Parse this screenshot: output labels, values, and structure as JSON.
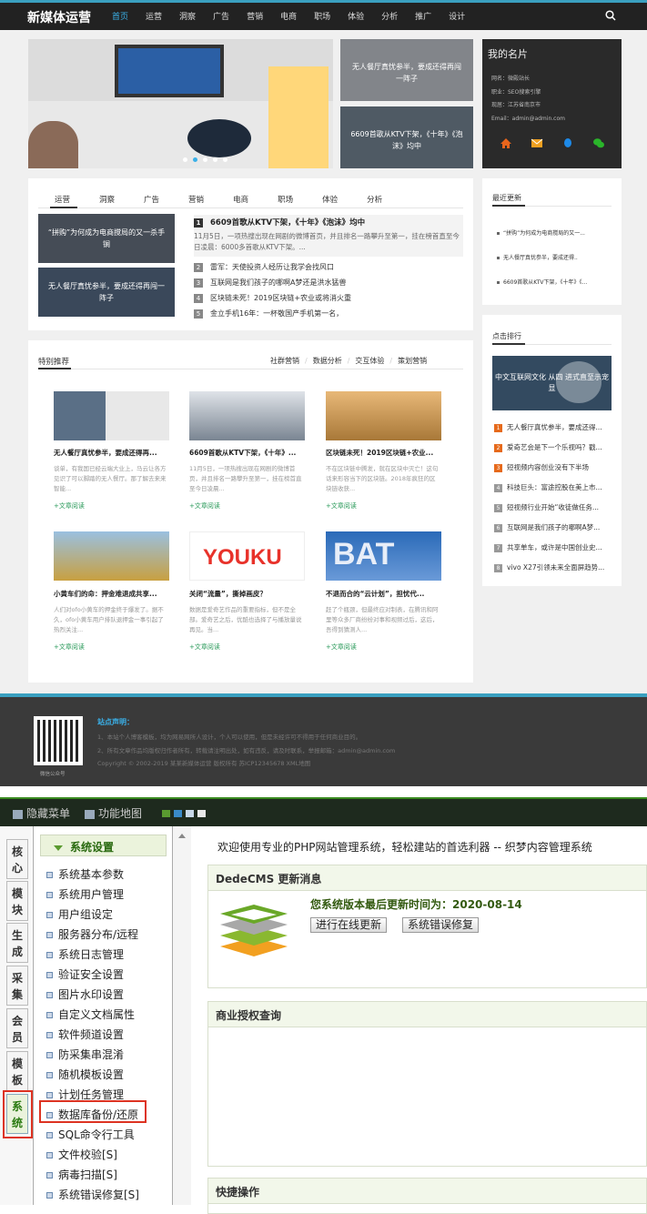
{
  "site": {
    "logo": "新媒体运营",
    "nav": [
      "首页",
      "运营",
      "洞察",
      "广告",
      "营销",
      "电商",
      "职场",
      "体验",
      "分析",
      "推广",
      "设计"
    ],
    "slider_thumbs": [
      "无人餐厅真忧参半，要成还得再闯一阵子",
      "6609首歌从KTV下架，《十年》《泡沫》均中"
    ],
    "card": {
      "title": "我的名片",
      "lines": [
        "网名：微殿站长",
        "职业：SEO搜索引擎",
        "现居：江苏省南京市",
        "Email：admin@admin.com"
      ]
    },
    "tabs": [
      "运营",
      "洞察",
      "广告",
      "营销",
      "电商",
      "职场",
      "体验",
      "分析"
    ],
    "news_imgs": [
      "“拼购”为何成为电商搅局的又一杀手锏",
      "无人餐厅真忧参半，要成还得再闯一阵子"
    ],
    "headline": {
      "num": "1",
      "title": "6609首歌从KTV下架，《十年》《泡沫》均中",
      "desc": "11月5日，一项热搜出现在网剧的微博首页，并且排名一路攀升至第一，挂在榜首直至今日凌晨：6000多首歌从KTV下架。..."
    },
    "news_list": [
      {
        "num": "2",
        "title": "雷军：天使投资人经历让我学会找风口"
      },
      {
        "num": "3",
        "title": "互联网是我们孩子的哪啊A梦还是洪水猛兽"
      },
      {
        "num": "4",
        "title": "区块链未死！2019区块链+农业或将消火重"
      },
      {
        "num": "5",
        "title": "金立手机16年：一杯敬国产手机第一名，"
      }
    ],
    "recent_title": "最近更新",
    "recent": [
      "“拼购”为何成为电商搅局的又一...",
      "无人餐厅真忧参半，要成还得..",
      "6609首歌从KTV下架，《十年》《..."
    ],
    "rank_title": "点击排行",
    "rank_img_text": "中文互联网文化 从四 进式直至示宠显",
    "rank": [
      {
        "num": "1",
        "title": "无人餐厅真忧参半，要成还得..."
      },
      {
        "num": "2",
        "title": "爱奇艺会是下一个乐视吗？戳..."
      },
      {
        "num": "3",
        "title": "短视频内容创业没有下半场"
      },
      {
        "num": "4",
        "title": "科技巨头：富途控股在美上市..."
      },
      {
        "num": "5",
        "title": "短视频行业开始“收徒做任务..."
      },
      {
        "num": "6",
        "title": "互联网是我们孩子的哪啊A梦..."
      },
      {
        "num": "7",
        "title": "共享单车，或许是中国创业史..."
      },
      {
        "num": "8",
        "title": "vivo X27引领未来全面屏趋势..."
      }
    ],
    "featured_title": "特别推荐",
    "featured_links": [
      "社群营销",
      "数据分析",
      "交互体验",
      "策划营销"
    ],
    "featured": [
      {
        "title": "无人餐厅真忧参半，要成还得再...",
        "desc": "谈单，有我国已经云端大业上，马云让各方见识了可以脚踏的无人餐厅。那了解去来来智能...",
        "more": "+文章阅读"
      },
      {
        "title": "6609首歌从KTV下架，《十年》...",
        "desc": "11月5日，一项热搜出现在网剧的微博首页，并且排名一路攀升至第一，挂在榜首直至今日凌晨...",
        "more": "+文章阅读"
      },
      {
        "title": "区块链未死！2019区块链+农业...",
        "desc": "不在区块链中腾发，就在区块中灭亡！这句话来形容当下的区块链。2018年疯狂的区块链收获...",
        "more": "+文章阅读"
      },
      {
        "title": "小黄车们的命：押金难退成共享...",
        "desc": "人们对ofo小黄车的押金终于爆发了。据不久，ofo小黄车用户排队退押金一事引起了热烈关注...",
        "more": "+文章阅读"
      },
      {
        "title": "关闭“流量”，撕掉画皮？",
        "desc": "数据是爱奇艺作品的重要指标，但不是全部。爱奇艺之后，优酷也选择了与播放量说再见。当...",
        "more": "+文章阅读"
      },
      {
        "title": "不退而合的“云计划”，担忧代...",
        "desc": "赶了个瓶颈，但最终应对制表，在腾讯和阿里等众多厂商纷纷对事和视频过后，这后，吾得到猜测人...",
        "more": "+文章阅读"
      }
    ],
    "footer": {
      "qr_label": "微信公众号",
      "title": "站点声明：",
      "lines": [
        "1、本站个人博客模板，均为网易网所人设计，个人可以使用，但是未经许可不得用于任何商业目的。",
        "2、所有文章作品均版权归作者所有，转载请注明出处，如有违反，请及时联系，举报邮箱：admin@admin.com",
        "Copyright © 2002-2019 某某新媒体运营 版权所有 苏ICP12345678 XML地图"
      ]
    }
  },
  "admin": {
    "topbar": {
      "hide_menu": "隐藏菜单",
      "site_map": "功能地图"
    },
    "swatches": [
      "#5a9a30",
      "#3a8ac8",
      "#c8d8e8",
      "#e8e8e8"
    ],
    "side_tabs": [
      "核心",
      "模块",
      "生成",
      "采集",
      "会员",
      "模板",
      "系统"
    ],
    "menu_title": "系统设置",
    "menu_items": [
      "系统基本参数",
      "系统用户管理",
      "用户组设定",
      "服务器分布/远程",
      "系统日志管理",
      "验证安全设置",
      "图片水印设置",
      "自定义文档属性",
      "软件频道设置",
      "防采集串混淆",
      "随机模板设置",
      "计划任务管理",
      "数据库备份/还原",
      "SQL命令行工具",
      "文件校验[S]",
      "病毒扫描[S]",
      "系统错误修复[S]"
    ],
    "welcome": "欢迎使用专业的PHP网站管理系统，轻松建站的首选利器 -- 织梦内容管理系统",
    "update_panel": {
      "title": "DedeCMS 更新消息",
      "status": "您系统版本最后更新时间为：2020-08-14",
      "btn_online": "进行在线更新",
      "btn_fix": "系统错误修复"
    },
    "license_title": "商业授权查询",
    "quick_title": "快捷操作"
  }
}
